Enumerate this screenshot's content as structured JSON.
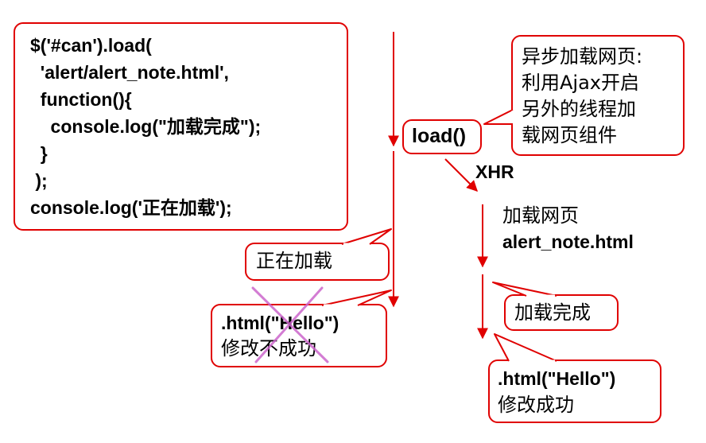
{
  "code_box": {
    "lines": [
      "$('#can').load(",
      "  'alert/alert_note.html',",
      "  function(){",
      "    console.log(\"加载完成\");",
      "  }",
      " );",
      "console.log('正在加载');"
    ]
  },
  "callout_async": {
    "lines": [
      "异步加载网页:",
      "利用Ajax开启",
      "另外的线程加",
      "载网页组件"
    ]
  },
  "load_box": {
    "label": "load()"
  },
  "xhr_label": "XHR",
  "loading_page": {
    "line1": "加载网页",
    "line2": "alert_note.html"
  },
  "loading_box": {
    "label": "正在加载"
  },
  "html_fail_box": {
    "code": ".html(\"Hello\")",
    "text": "修改不成功"
  },
  "load_done_box": {
    "label": "加载完成"
  },
  "html_ok_box": {
    "code": ".html(\"Hello\")",
    "text": "修改成功"
  },
  "colors": {
    "accent": "#e00000",
    "cross": "#cc66cc"
  }
}
